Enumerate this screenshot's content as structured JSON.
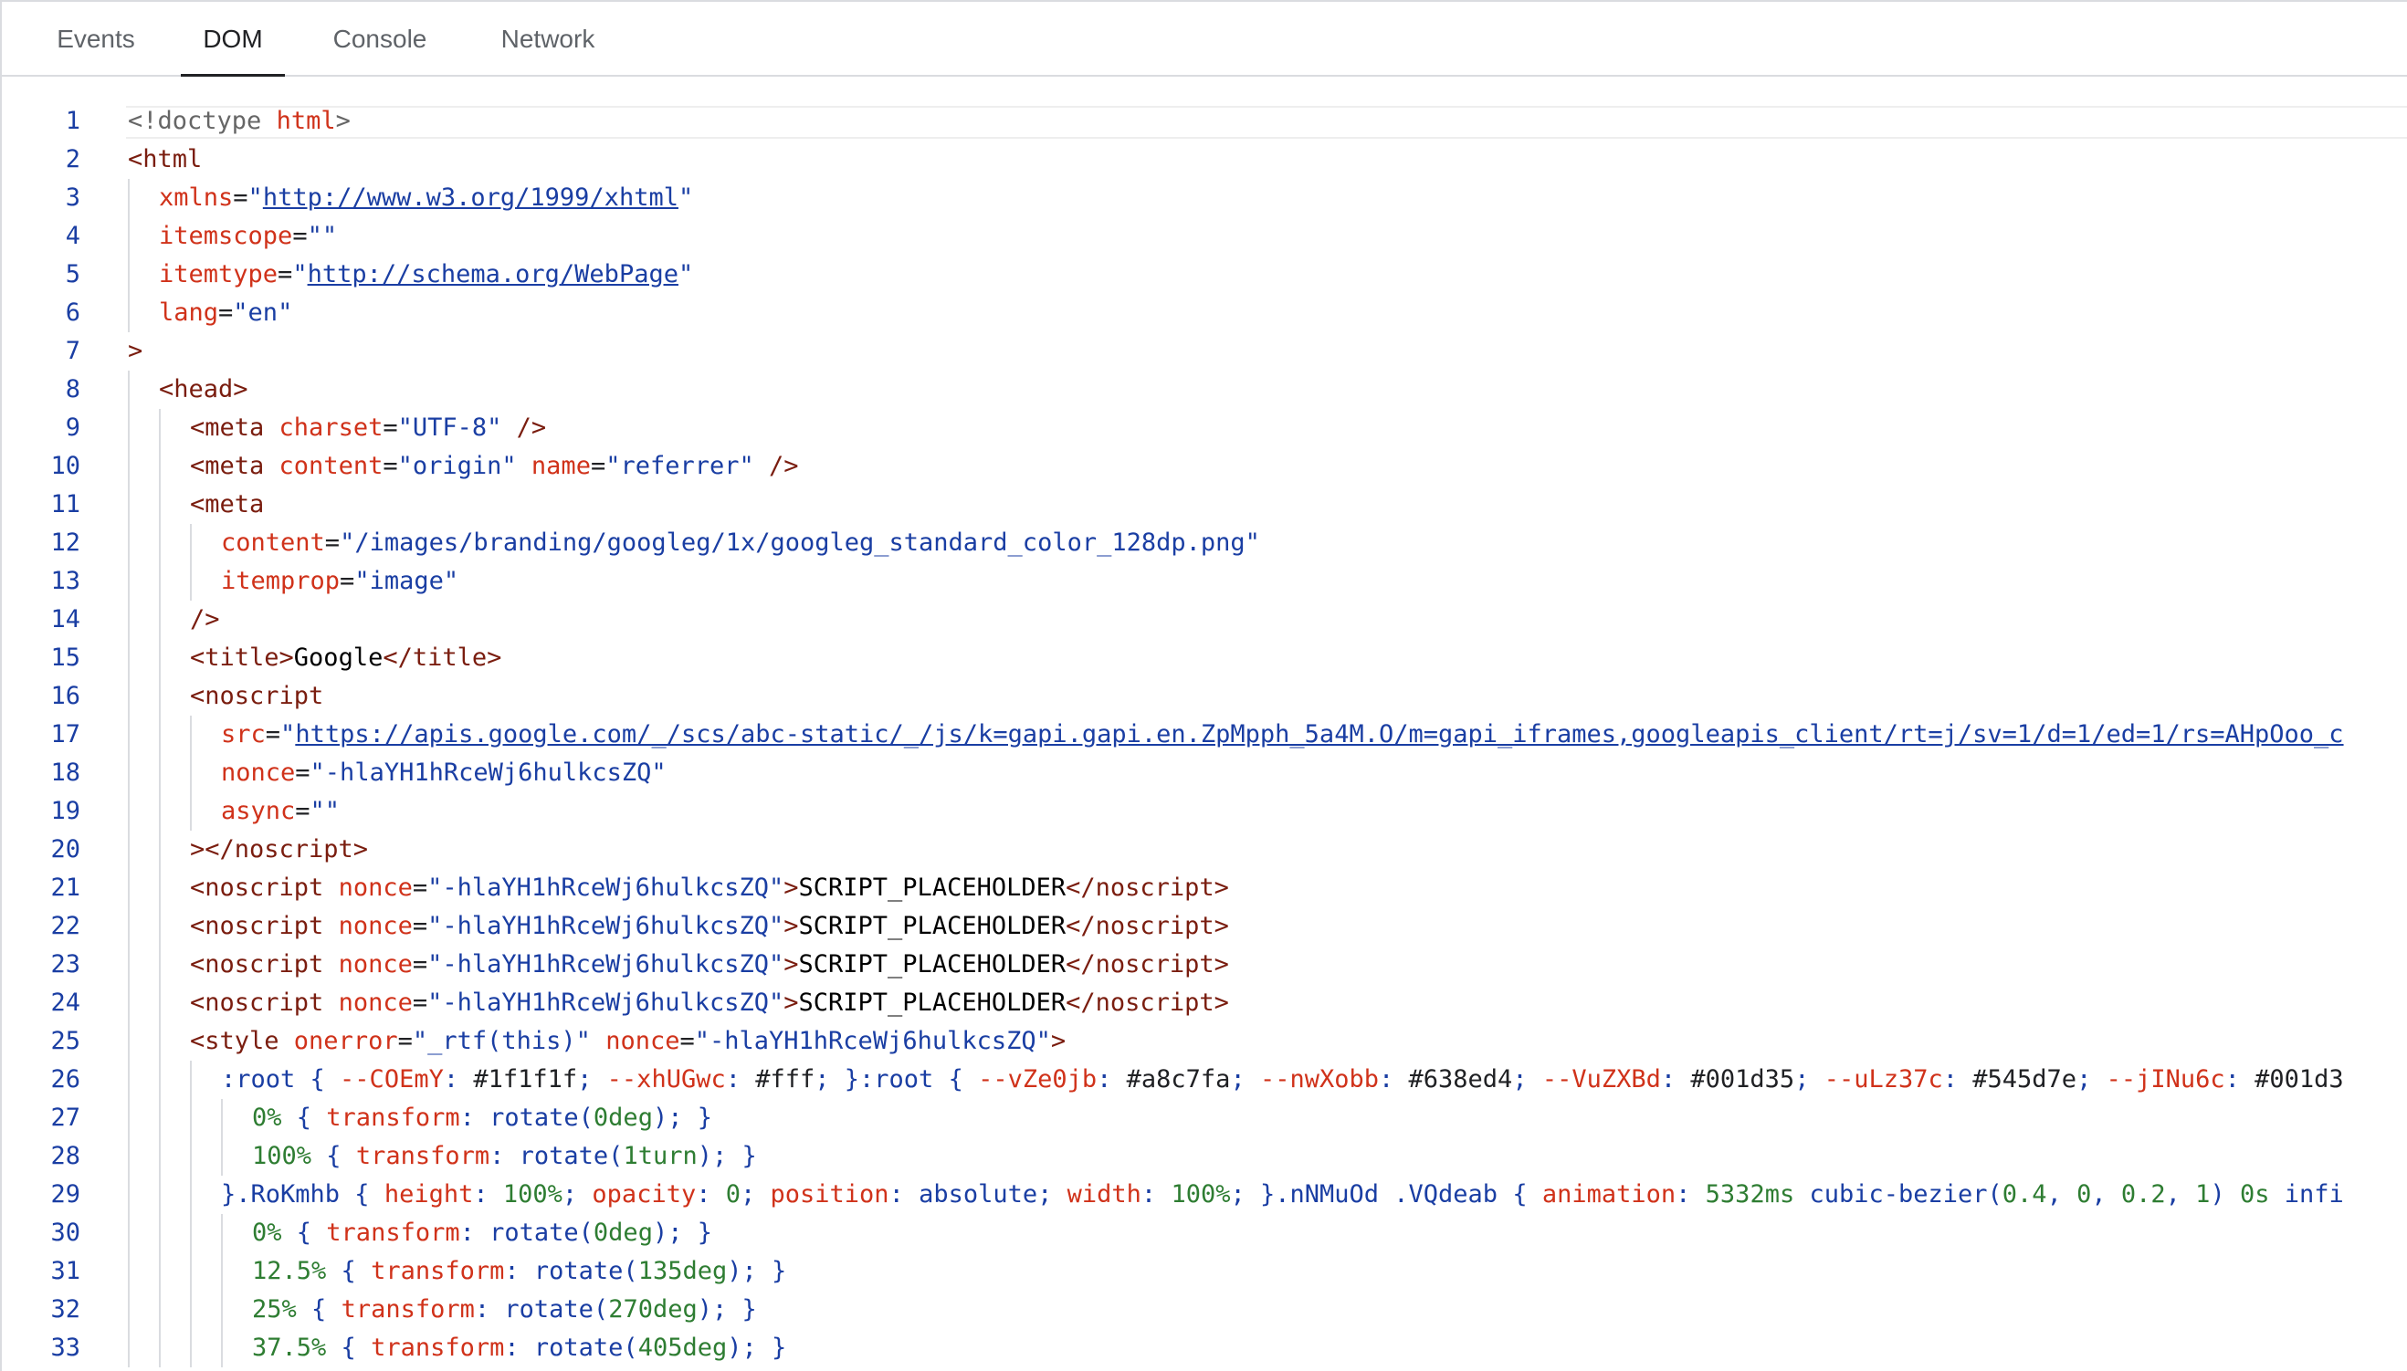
{
  "tabs": [
    {
      "label": "Events",
      "active": false
    },
    {
      "label": "DOM",
      "active": true
    },
    {
      "label": "Console",
      "active": false
    },
    {
      "label": "Network",
      "active": false
    }
  ],
  "colors": {
    "tag": "#7a1d0f",
    "attribute": "#d0321a",
    "value": "#1a3ea3",
    "number": "#2e7d32",
    "line_number": "#1a3ea3"
  },
  "lines": [
    {
      "n": "1",
      "indent": 0,
      "current": true,
      "tokens": [
        [
          "g",
          "<!doctype "
        ],
        [
          "a",
          "html"
        ],
        [
          "g",
          ">"
        ]
      ]
    },
    {
      "n": "2",
      "indent": 0,
      "tokens": [
        [
          "t",
          "<html"
        ]
      ]
    },
    {
      "n": "3",
      "indent": 1,
      "tokens": [
        [
          "a",
          "xmlns"
        ],
        [
          "p",
          "="
        ],
        [
          "v",
          "\""
        ],
        [
          "u",
          "http://www.w3.org/1999/xhtml"
        ],
        [
          "v",
          "\""
        ]
      ]
    },
    {
      "n": "4",
      "indent": 1,
      "tokens": [
        [
          "a",
          "itemscope"
        ],
        [
          "p",
          "="
        ],
        [
          "v",
          "\"\""
        ]
      ]
    },
    {
      "n": "5",
      "indent": 1,
      "tokens": [
        [
          "a",
          "itemtype"
        ],
        [
          "p",
          "="
        ],
        [
          "v",
          "\""
        ],
        [
          "u",
          "http://schema.org/WebPage"
        ],
        [
          "v",
          "\""
        ]
      ]
    },
    {
      "n": "6",
      "indent": 1,
      "tokens": [
        [
          "a",
          "lang"
        ],
        [
          "p",
          "="
        ],
        [
          "v",
          "\"en\""
        ]
      ]
    },
    {
      "n": "7",
      "indent": 0,
      "tokens": [
        [
          "t",
          ">"
        ]
      ]
    },
    {
      "n": "8",
      "indent": 1,
      "tokens": [
        [
          "t",
          "<head>"
        ]
      ]
    },
    {
      "n": "9",
      "indent": 2,
      "tokens": [
        [
          "t",
          "<meta "
        ],
        [
          "a",
          "charset"
        ],
        [
          "p",
          "="
        ],
        [
          "v",
          "\"UTF-8\""
        ],
        [
          "t",
          " />"
        ]
      ]
    },
    {
      "n": "10",
      "indent": 2,
      "tokens": [
        [
          "t",
          "<meta "
        ],
        [
          "a",
          "content"
        ],
        [
          "p",
          "="
        ],
        [
          "v",
          "\"origin\""
        ],
        [
          "p",
          " "
        ],
        [
          "a",
          "name"
        ],
        [
          "p",
          "="
        ],
        [
          "v",
          "\"referrer\""
        ],
        [
          "t",
          " />"
        ]
      ]
    },
    {
      "n": "11",
      "indent": 2,
      "tokens": [
        [
          "t",
          "<meta"
        ]
      ]
    },
    {
      "n": "12",
      "indent": 3,
      "tokens": [
        [
          "a",
          "content"
        ],
        [
          "p",
          "="
        ],
        [
          "v",
          "\"/images/branding/googleg/1x/googleg_standard_color_128dp.png\""
        ]
      ]
    },
    {
      "n": "13",
      "indent": 3,
      "tokens": [
        [
          "a",
          "itemprop"
        ],
        [
          "p",
          "="
        ],
        [
          "v",
          "\"image\""
        ]
      ]
    },
    {
      "n": "14",
      "indent": 2,
      "tokens": [
        [
          "t",
          "/>"
        ]
      ]
    },
    {
      "n": "15",
      "indent": 2,
      "tokens": [
        [
          "t",
          "<title>"
        ],
        [
          "tx",
          "Google"
        ],
        [
          "t",
          "</title>"
        ]
      ]
    },
    {
      "n": "16",
      "indent": 2,
      "tokens": [
        [
          "t",
          "<noscript"
        ]
      ]
    },
    {
      "n": "17",
      "indent": 3,
      "tokens": [
        [
          "a",
          "src"
        ],
        [
          "p",
          "="
        ],
        [
          "v",
          "\""
        ],
        [
          "u",
          "https://apis.google.com/_/scs/abc-static/_/js/k=gapi.gapi.en.ZpMpph_5a4M.O/m=gapi_iframes,googleapis_client/rt=j/sv=1/d=1/ed=1/rs=AHpOoo_c"
        ]
      ]
    },
    {
      "n": "18",
      "indent": 3,
      "tokens": [
        [
          "a",
          "nonce"
        ],
        [
          "p",
          "="
        ],
        [
          "v",
          "\"-hlaYH1hRceWj6hulkcsZQ\""
        ]
      ]
    },
    {
      "n": "19",
      "indent": 3,
      "tokens": [
        [
          "a",
          "async"
        ],
        [
          "p",
          "="
        ],
        [
          "v",
          "\"\""
        ]
      ]
    },
    {
      "n": "20",
      "indent": 2,
      "tokens": [
        [
          "t",
          "></noscript>"
        ]
      ]
    },
    {
      "n": "21",
      "indent": 2,
      "tokens": [
        [
          "t",
          "<noscript "
        ],
        [
          "a",
          "nonce"
        ],
        [
          "p",
          "="
        ],
        [
          "v",
          "\"-hlaYH1hRceWj6hulkcsZQ\""
        ],
        [
          "t",
          ">"
        ],
        [
          "tx",
          "SCRIPT_PLACEHOLDER"
        ],
        [
          "t",
          "</noscript>"
        ]
      ]
    },
    {
      "n": "22",
      "indent": 2,
      "tokens": [
        [
          "t",
          "<noscript "
        ],
        [
          "a",
          "nonce"
        ],
        [
          "p",
          "="
        ],
        [
          "v",
          "\"-hlaYH1hRceWj6hulkcsZQ\""
        ],
        [
          "t",
          ">"
        ],
        [
          "tx",
          "SCRIPT_PLACEHOLDER"
        ],
        [
          "t",
          "</noscript>"
        ]
      ]
    },
    {
      "n": "23",
      "indent": 2,
      "tokens": [
        [
          "t",
          "<noscript "
        ],
        [
          "a",
          "nonce"
        ],
        [
          "p",
          "="
        ],
        [
          "v",
          "\"-hlaYH1hRceWj6hulkcsZQ\""
        ],
        [
          "t",
          ">"
        ],
        [
          "tx",
          "SCRIPT_PLACEHOLDER"
        ],
        [
          "t",
          "</noscript>"
        ]
      ]
    },
    {
      "n": "24",
      "indent": 2,
      "tokens": [
        [
          "t",
          "<noscript "
        ],
        [
          "a",
          "nonce"
        ],
        [
          "p",
          "="
        ],
        [
          "v",
          "\"-hlaYH1hRceWj6hulkcsZQ\""
        ],
        [
          "t",
          ">"
        ],
        [
          "tx",
          "SCRIPT_PLACEHOLDER"
        ],
        [
          "t",
          "</noscript>"
        ]
      ]
    },
    {
      "n": "25",
      "indent": 2,
      "tokens": [
        [
          "t",
          "<style "
        ],
        [
          "a",
          "onerror"
        ],
        [
          "p",
          "="
        ],
        [
          "v",
          "\"_rtf(this)\""
        ],
        [
          "p",
          " "
        ],
        [
          "a",
          "nonce"
        ],
        [
          "p",
          "="
        ],
        [
          "v",
          "\"-hlaYH1hRceWj6hulkcsZQ\""
        ],
        [
          "t",
          ">"
        ]
      ]
    },
    {
      "n": "26",
      "indent": 3,
      "tokens": [
        [
          "cs",
          ":root { "
        ],
        [
          "cp",
          "--COEmY"
        ],
        [
          "cs",
          ": "
        ],
        [
          "p",
          "#1f1f1f"
        ],
        [
          "cs",
          "; "
        ],
        [
          "cp",
          "--xhUGwc"
        ],
        [
          "cs",
          ": "
        ],
        [
          "p",
          "#fff"
        ],
        [
          "cs",
          "; }:root { "
        ],
        [
          "cp",
          "--vZe0jb"
        ],
        [
          "cs",
          ": "
        ],
        [
          "p",
          "#a8c7fa"
        ],
        [
          "cs",
          "; "
        ],
        [
          "cp",
          "--nwXobb"
        ],
        [
          "cs",
          ": "
        ],
        [
          "p",
          "#638ed4"
        ],
        [
          "cs",
          "; "
        ],
        [
          "cp",
          "--VuZXBd"
        ],
        [
          "cs",
          ": "
        ],
        [
          "p",
          "#001d35"
        ],
        [
          "cs",
          "; "
        ],
        [
          "cp",
          "--uLz37c"
        ],
        [
          "cs",
          ": "
        ],
        [
          "p",
          "#545d7e"
        ],
        [
          "cs",
          "; "
        ],
        [
          "cp",
          "--jINu6c"
        ],
        [
          "cs",
          ": "
        ],
        [
          "p",
          "#001d3"
        ]
      ]
    },
    {
      "n": "27",
      "indent": 4,
      "tokens": [
        [
          "cn",
          "0%"
        ],
        [
          "cs",
          " { "
        ],
        [
          "cp",
          "transform"
        ],
        [
          "cs",
          ": "
        ],
        [
          "cv",
          "rotate("
        ],
        [
          "cn",
          "0deg"
        ],
        [
          "cv",
          ")"
        ],
        [
          "cs",
          "; }"
        ]
      ]
    },
    {
      "n": "28",
      "indent": 4,
      "tokens": [
        [
          "cn",
          "100%"
        ],
        [
          "cs",
          " { "
        ],
        [
          "cp",
          "transform"
        ],
        [
          "cs",
          ": "
        ],
        [
          "cv",
          "rotate("
        ],
        [
          "cn",
          "1turn"
        ],
        [
          "cv",
          ")"
        ],
        [
          "cs",
          "; }"
        ]
      ]
    },
    {
      "n": "29",
      "indent": 3,
      "tokens": [
        [
          "cs",
          "}.RoKmhb { "
        ],
        [
          "cp",
          "height"
        ],
        [
          "cs",
          ": "
        ],
        [
          "cn",
          "100%"
        ],
        [
          "cs",
          "; "
        ],
        [
          "cp",
          "opacity"
        ],
        [
          "cs",
          ": "
        ],
        [
          "cn",
          "0"
        ],
        [
          "cs",
          "; "
        ],
        [
          "cp",
          "position"
        ],
        [
          "cs",
          ": "
        ],
        [
          "cv",
          "absolute"
        ],
        [
          "cs",
          "; "
        ],
        [
          "cp",
          "width"
        ],
        [
          "cs",
          ": "
        ],
        [
          "cn",
          "100%"
        ],
        [
          "cs",
          "; }.nNMuOd .VQdeab { "
        ],
        [
          "cp",
          "animation"
        ],
        [
          "cs",
          ": "
        ],
        [
          "cn",
          "5332ms"
        ],
        [
          "cv",
          " cubic-bezier("
        ],
        [
          "cn",
          "0.4"
        ],
        [
          "cv",
          ", "
        ],
        [
          "cn",
          "0"
        ],
        [
          "cv",
          ", "
        ],
        [
          "cn",
          "0.2"
        ],
        [
          "cv",
          ", "
        ],
        [
          "cn",
          "1"
        ],
        [
          "cv",
          ") "
        ],
        [
          "cn",
          "0s"
        ],
        [
          "cv",
          " infi"
        ]
      ]
    },
    {
      "n": "30",
      "indent": 4,
      "tokens": [
        [
          "cn",
          "0%"
        ],
        [
          "cs",
          " { "
        ],
        [
          "cp",
          "transform"
        ],
        [
          "cs",
          ": "
        ],
        [
          "cv",
          "rotate("
        ],
        [
          "cn",
          "0deg"
        ],
        [
          "cv",
          ")"
        ],
        [
          "cs",
          "; }"
        ]
      ]
    },
    {
      "n": "31",
      "indent": 4,
      "tokens": [
        [
          "cn",
          "12.5%"
        ],
        [
          "cs",
          " { "
        ],
        [
          "cp",
          "transform"
        ],
        [
          "cs",
          ": "
        ],
        [
          "cv",
          "rotate("
        ],
        [
          "cn",
          "135deg"
        ],
        [
          "cv",
          ")"
        ],
        [
          "cs",
          "; }"
        ]
      ]
    },
    {
      "n": "32",
      "indent": 4,
      "tokens": [
        [
          "cn",
          "25%"
        ],
        [
          "cs",
          " { "
        ],
        [
          "cp",
          "transform"
        ],
        [
          "cs",
          ": "
        ],
        [
          "cv",
          "rotate("
        ],
        [
          "cn",
          "270deg"
        ],
        [
          "cv",
          ")"
        ],
        [
          "cs",
          "; }"
        ]
      ]
    },
    {
      "n": "33",
      "indent": 4,
      "tokens": [
        [
          "cn",
          "37.5%"
        ],
        [
          "cs",
          " { "
        ],
        [
          "cp",
          "transform"
        ],
        [
          "cs",
          ": "
        ],
        [
          "cv",
          "rotate("
        ],
        [
          "cn",
          "405deg"
        ],
        [
          "cv",
          ")"
        ],
        [
          "cs",
          "; }"
        ]
      ]
    }
  ]
}
